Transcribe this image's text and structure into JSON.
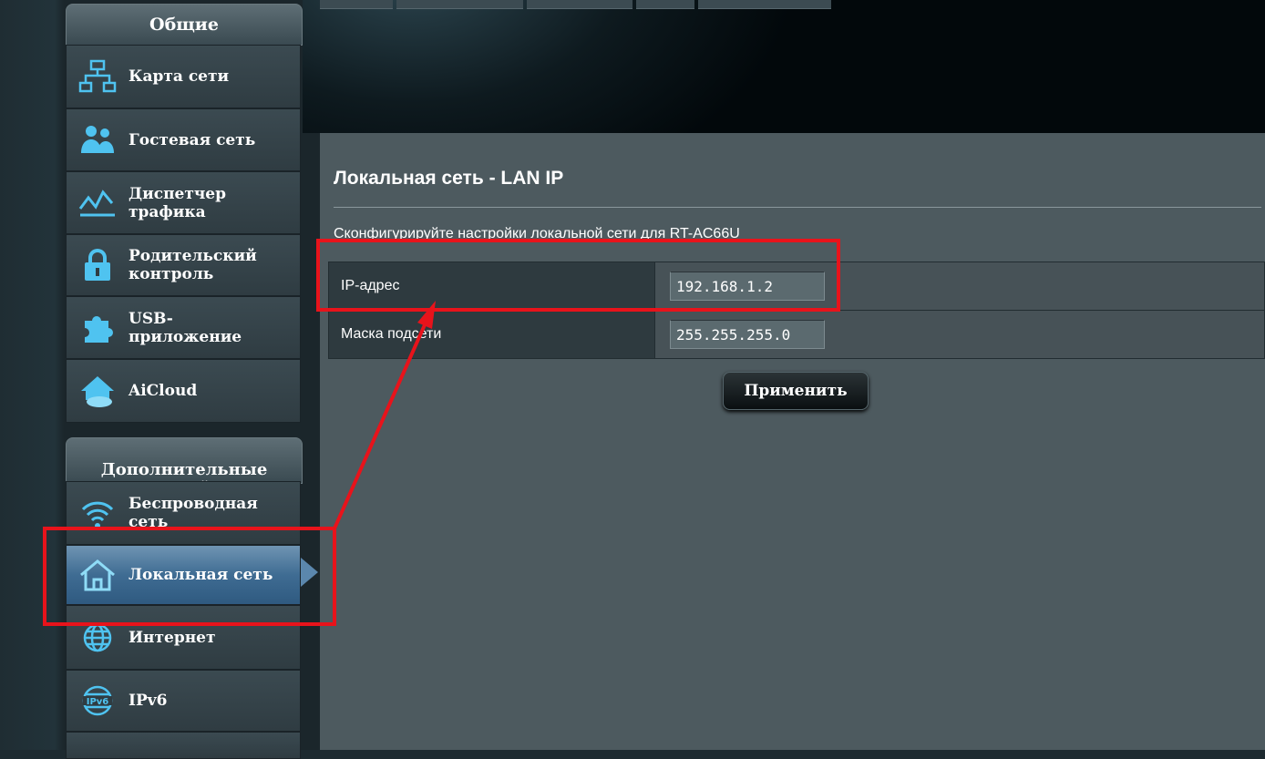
{
  "sidebar": {
    "general_header": "Общие",
    "general_items": [
      {
        "label": "Карта сети",
        "icon": "network-map-icon"
      },
      {
        "label": "Гостевая сеть",
        "icon": "guest-network-icon"
      },
      {
        "label": "Диспетчер\nтрафика",
        "icon": "traffic-manager-icon"
      },
      {
        "label": "Родительский\nконтроль",
        "icon": "parental-lock-icon"
      },
      {
        "label": "USB-\nприложение",
        "icon": "usb-puzzle-icon"
      },
      {
        "label": "AiCloud",
        "icon": "aicloud-icon"
      }
    ],
    "advanced_header": "Дополнительные\nнастройки",
    "advanced_items": [
      {
        "label": "Беспроводная\nсеть",
        "icon": "wireless-icon"
      },
      {
        "label": "Локальная сеть",
        "icon": "lan-home-icon",
        "active": true
      },
      {
        "label": "Интернет",
        "icon": "globe-icon"
      },
      {
        "label": "IPv6",
        "icon": "ipv6-globe-icon"
      }
    ]
  },
  "main": {
    "title": "Локальная сеть - LAN IP",
    "description": "Сконфигурируйте настройки локальной сети для RT-AC66U",
    "fields": [
      {
        "label": "IP-адрес",
        "value": "192.168.1.2"
      },
      {
        "label": "Маска подсети",
        "value": "255.255.255.0"
      }
    ],
    "apply_label": "Применить"
  },
  "colors": {
    "annotation": "#e8131b",
    "active_item": "#4f7ca3",
    "content_bg": "#4d5a5f"
  }
}
